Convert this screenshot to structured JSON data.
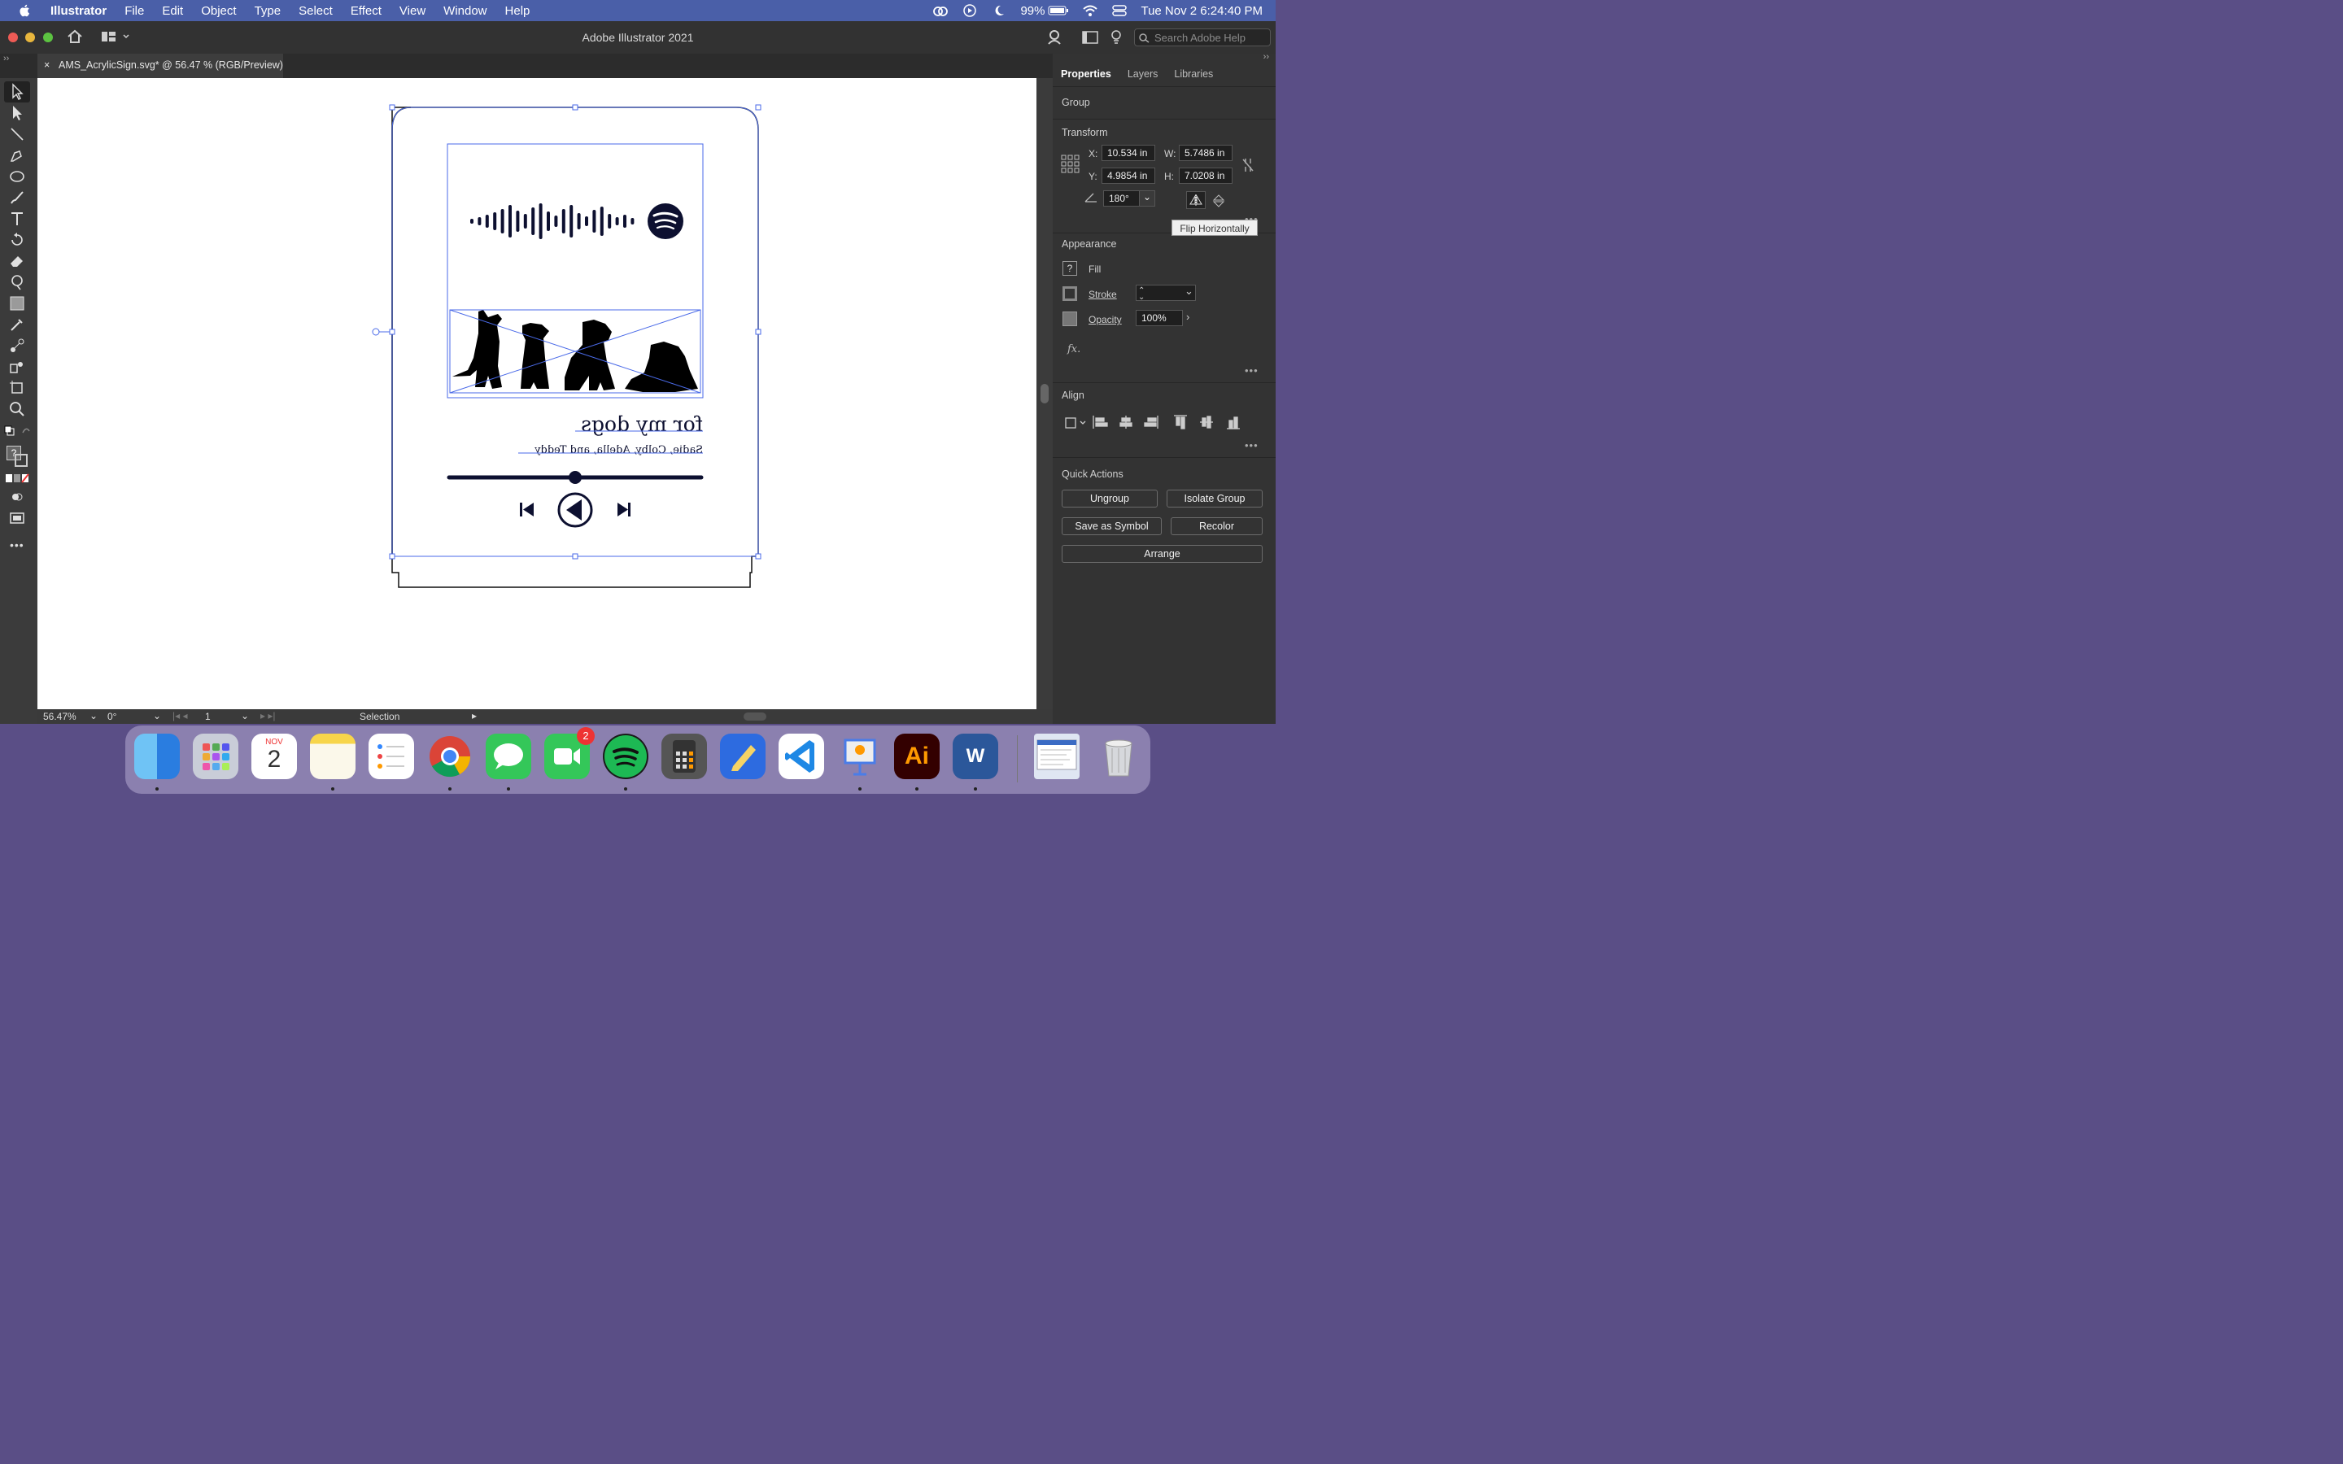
{
  "menubar": {
    "app_name": "Illustrator",
    "menus": [
      "File",
      "Edit",
      "Object",
      "Type",
      "Select",
      "Effect",
      "View",
      "Window",
      "Help"
    ],
    "battery": "99%",
    "datetime": "Tue Nov 2  6:24:40 PM"
  },
  "window": {
    "title": "Adobe Illustrator 2021",
    "search_placeholder": "Search Adobe Help"
  },
  "document_tab": {
    "label": "AMS_AcrylicSign.svg* @ 56.47 % (RGB/Preview)",
    "close": "×"
  },
  "artwork": {
    "headline": "for my dogs",
    "subline": "Sadie, Colby, Adella, and Teddy"
  },
  "statusbar": {
    "zoom": "56.47%",
    "rotation": "0°",
    "artboard": "1",
    "tool": "Selection"
  },
  "panel": {
    "tabs": [
      "Properties",
      "Layers",
      "Libraries"
    ],
    "selection_type": "Group",
    "transform": {
      "heading": "Transform",
      "x_label": "X:",
      "x": "10.534 in",
      "y_label": "Y:",
      "y": "4.9854 in",
      "w_label": "W:",
      "w": "5.7486 in",
      "h_label": "H:",
      "h": "7.0208 in",
      "angle": "180°"
    },
    "tooltip": "Flip Horizontally",
    "appearance": {
      "heading": "Appearance",
      "fill": "Fill",
      "fill_swatch": "?",
      "stroke": "Stroke",
      "opacity_label": "Opacity",
      "opacity": "100%",
      "fx": "fx."
    },
    "align_heading": "Align",
    "quick_actions": {
      "heading": "Quick Actions",
      "ungroup": "Ungroup",
      "isolate": "Isolate Group",
      "save_symbol": "Save as Symbol",
      "recolor": "Recolor",
      "arrange": "Arrange"
    }
  },
  "dock": {
    "calendar_month": "NOV",
    "calendar_day": "2",
    "facetime_badge": "2",
    "illustrator_label": "Ai",
    "word_label": "W"
  },
  "colors": {
    "menubar": "#4a5fa8",
    "selection": "#4a6ae8",
    "artwork": "#0d1030"
  }
}
